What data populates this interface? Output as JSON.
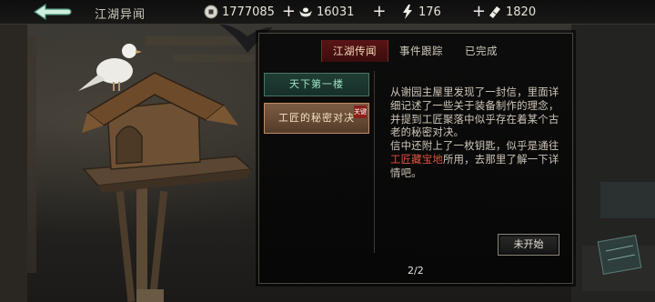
{
  "header": {
    "title": "江湖异闻",
    "resources": [
      {
        "icon": "coin-icon",
        "value": "1777085"
      },
      {
        "icon": "silver-ingot-icon",
        "value": "16031"
      },
      {
        "icon": "lightning-icon",
        "value": "176"
      },
      {
        "icon": "ticket-icon",
        "value": "1820"
      }
    ]
  },
  "tabs": [
    {
      "label": "江湖传闻",
      "active": true
    },
    {
      "label": "事件跟踪",
      "active": false
    },
    {
      "label": "已完成",
      "active": false
    }
  ],
  "quests": [
    {
      "label": "天下第一楼",
      "state": "normal"
    },
    {
      "label": "工匠的秘密对决",
      "state": "selected",
      "badge": "关键"
    }
  ],
  "description": {
    "p1": "从谢园主屋里发现了一封信，里面详细记述了一些关于装备制作的理念，并提到工匠聚落中似乎存在着某个古老的秘密对决。",
    "p2_before": "信中还附上了一枚钥匙，似乎是通往",
    "p2_highlight": "工匠藏宝地",
    "p2_after": "所用，去那里了解一下详情吧。"
  },
  "status_button": "未开始",
  "pager": "2/2",
  "colors": {
    "accent_red": "#e0533d",
    "tab_active": "#5a1414",
    "quest_green": "#9fe3c4"
  }
}
